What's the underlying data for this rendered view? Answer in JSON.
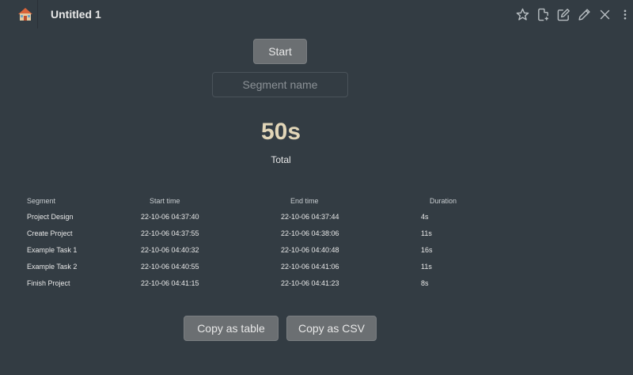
{
  "window": {
    "title": "Untitled 1"
  },
  "toolbar": {
    "icons": [
      "home-icon",
      "star-icon",
      "new-file-icon",
      "edit-icon",
      "pencil-icon",
      "close-icon",
      "more-vertical-icon"
    ]
  },
  "controls": {
    "start_label": "Start",
    "segment_placeholder": "Segment name",
    "segment_value": ""
  },
  "summary": {
    "total_time": "50s",
    "total_label": "Total"
  },
  "table": {
    "headers": {
      "segment": "Segment",
      "start": "Start time",
      "end": "End time",
      "duration": "Duration"
    },
    "rows": [
      {
        "segment": "Project Design",
        "start": "22-10-06 04:37:40",
        "end": "22-10-06 04:37:44",
        "duration": "4s"
      },
      {
        "segment": "Create Project",
        "start": "22-10-06 04:37:55",
        "end": "22-10-06 04:38:06",
        "duration": "11s"
      },
      {
        "segment": "Example Task 1",
        "start": "22-10-06 04:40:32",
        "end": "22-10-06 04:40:48",
        "duration": "16s"
      },
      {
        "segment": "Example Task 2",
        "start": "22-10-06 04:40:55",
        "end": "22-10-06 04:41:06",
        "duration": "11s"
      },
      {
        "segment": "Finish Project",
        "start": "22-10-06 04:41:15",
        "end": "22-10-06 04:41:23",
        "duration": "8s"
      }
    ]
  },
  "buttons": {
    "copy_table": "Copy as table",
    "copy_csv": "Copy as CSV"
  },
  "colors": {
    "background": "#333c43",
    "button": "#6b6f72",
    "total_accent": "#e2d6b8"
  }
}
